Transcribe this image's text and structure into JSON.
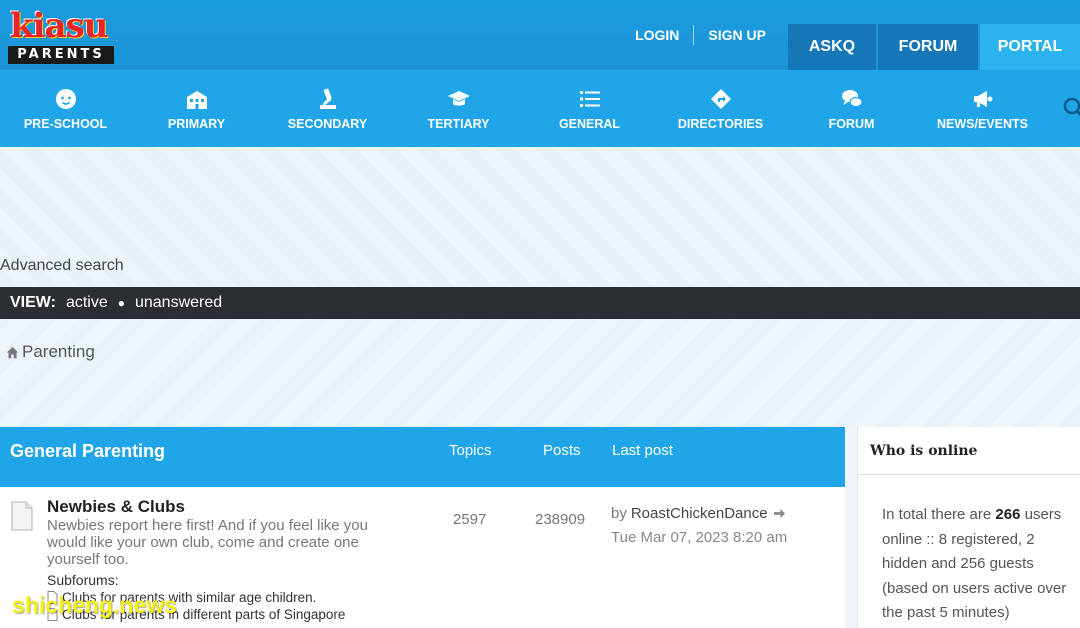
{
  "logo": {
    "script": "kiasu",
    "sub": "PARENTS"
  },
  "top_links": {
    "login": "LOGIN",
    "signup": "SIGN UP"
  },
  "top_tabs": {
    "askq": "ASKQ",
    "forum": "FORUM",
    "portal": "PORTAL"
  },
  "categories": [
    {
      "label": "PRE-SCHOOL",
      "icon": "baby-icon"
    },
    {
      "label": "PRIMARY",
      "icon": "school-icon"
    },
    {
      "label": "SECONDARY",
      "icon": "microscope-icon"
    },
    {
      "label": "TERTIARY",
      "icon": "graduation-cap-icon"
    },
    {
      "label": "GENERAL",
      "icon": "list-icon"
    },
    {
      "label": "DIRECTORIES",
      "icon": "directions-icon"
    },
    {
      "label": "FORUM",
      "icon": "chat-icon"
    },
    {
      "label": "NEWS/EVENTS",
      "icon": "megaphone-icon"
    }
  ],
  "search": {
    "advanced_label": "Advanced search"
  },
  "view_bar": {
    "label": "VIEW:",
    "active": "active",
    "unanswered": "unanswered"
  },
  "breadcrumb": {
    "label": "Parenting"
  },
  "forum": {
    "section_title": "General Parenting",
    "col_topics": "Topics",
    "col_posts": "Posts",
    "col_last_post": "Last post",
    "rows": [
      {
        "title": "Newbies & Clubs",
        "description": "Newbies report here first! And if you feel like you would like your own club, come and create one yourself too.",
        "subforums_label": "Subforums:",
        "subforums": [
          "Clubs for parents with similar age children.",
          "Clubs for parents in different parts of Singapore"
        ],
        "topics": "2597",
        "posts": "238909",
        "last_post_by": "by",
        "last_post_user": "RoastChickenDance",
        "last_post_date": "Tue Mar 07, 2023 8:20 am"
      }
    ]
  },
  "who_online": {
    "title": "Who is online",
    "text_pre": "In total there are",
    "total": "266",
    "text_post": "users online :: 8 registered, 2 hidden and 256 guests (based on users active over the past 5 minutes)"
  },
  "watermark": "shicheng.news",
  "colors": {
    "header_blue": "#1b9bdf",
    "nav_blue": "#1fa5e8",
    "dark_tab": "#1577b8",
    "view_bar": "#2b2f33"
  }
}
